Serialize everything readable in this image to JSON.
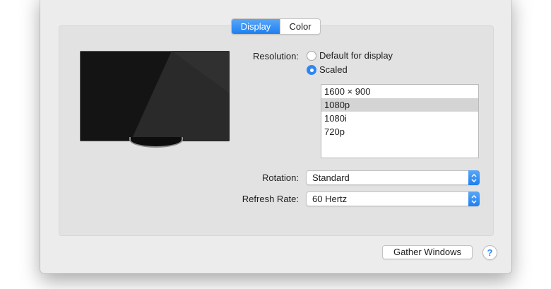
{
  "tabs": [
    {
      "label": "Display",
      "active": true
    },
    {
      "label": "Color",
      "active": false
    }
  ],
  "display": {
    "image_icon": "tv-monitor-icon",
    "resolution_label": "Resolution:",
    "resolution_options": [
      {
        "label": "Default for display",
        "selected": false
      },
      {
        "label": "Scaled",
        "selected": true
      }
    ],
    "scaled_list": [
      {
        "label": "1600 × 900",
        "selected": false
      },
      {
        "label": "1080p",
        "selected": true
      },
      {
        "label": "1080i",
        "selected": false
      },
      {
        "label": "720p",
        "selected": false
      }
    ],
    "rotation_label": "Rotation:",
    "rotation_value": "Standard",
    "refresh_label": "Refresh Rate:",
    "refresh_value": "60 Hertz"
  },
  "footer": {
    "gather_label": "Gather Windows",
    "help_label": "?"
  },
  "colors": {
    "accent": "#2f86f3",
    "window_bg": "#ececec",
    "panel_bg": "#e2e2e2",
    "list_selected": "#d4d4d4"
  }
}
